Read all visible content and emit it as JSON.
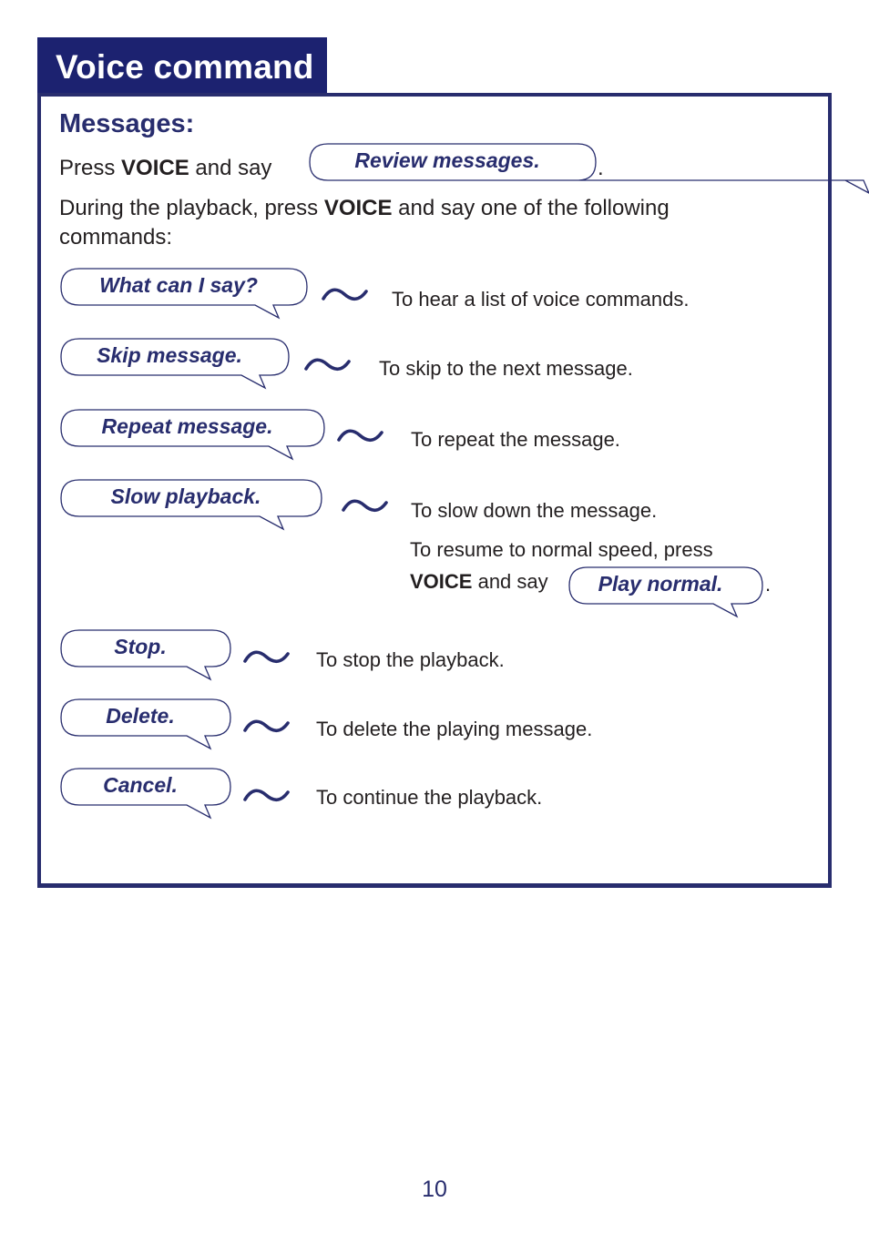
{
  "header": {
    "title": "Voice command"
  },
  "section": {
    "title": "Messages:",
    "intro": {
      "before": "Press ",
      "key": "VOICE",
      "after": " and say",
      "command": "Review messages.",
      "end": "."
    },
    "during": {
      "before": "During the playback, press ",
      "key": "VOICE",
      "after": " and say one of the following commands:"
    }
  },
  "commands": [
    {
      "command": "What can I say?",
      "description": "To hear a list of voice commands."
    },
    {
      "command": "Skip message.",
      "description": "To skip to the next message."
    },
    {
      "command": "Repeat message.",
      "description": "To repeat the message."
    },
    {
      "command": "Slow playback.",
      "description": "To slow down the message."
    },
    {
      "command": "Stop.",
      "description": "To stop the playback."
    },
    {
      "command": "Delete.",
      "description": "To delete the playing message."
    },
    {
      "command": "Cancel.",
      "description": "To continue the playback."
    }
  ],
  "resume_note": {
    "line1": "To resume to normal speed, press",
    "key": "VOICE",
    "after": " and say",
    "command": "Play normal.",
    "end": "."
  },
  "icons": {
    "bubble": "speech-bubble-icon",
    "tilde": "wave-tilde-icon"
  },
  "colors": {
    "navy": "#1c2270",
    "border": "#282d6e",
    "text": "#231f20"
  },
  "page_number": "10"
}
